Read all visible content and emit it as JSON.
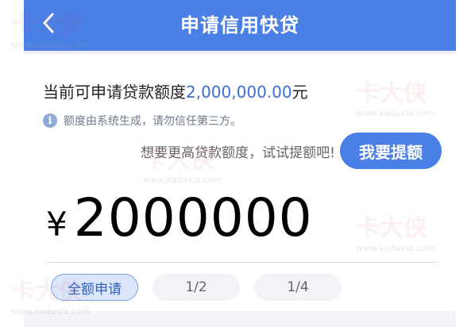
{
  "header": {
    "title": "申请信用快贷",
    "back_icon": "chevron-left-icon"
  },
  "limit": {
    "prefix": "当前可申请贷款额度",
    "amount": "2,000,000.00",
    "unit": "元"
  },
  "notice": {
    "icon": "info-icon",
    "text": "额度由系统生成，请勿信任第三方。"
  },
  "raise": {
    "prompt": "想要更高贷款额度，试试提额吧!",
    "button_label": "我要提额"
  },
  "amount": {
    "currency": "¥",
    "value": "2000000"
  },
  "chips": [
    {
      "label": "全额申请",
      "selected": true
    },
    {
      "label": "1/2",
      "selected": false
    },
    {
      "label": "1/4",
      "selected": false
    }
  ],
  "watermark": {
    "text": "卡大侠",
    "url": "www.kadaxia.com"
  },
  "colors": {
    "brand": "#4a7fe6",
    "amount": "#3b6fd6"
  }
}
